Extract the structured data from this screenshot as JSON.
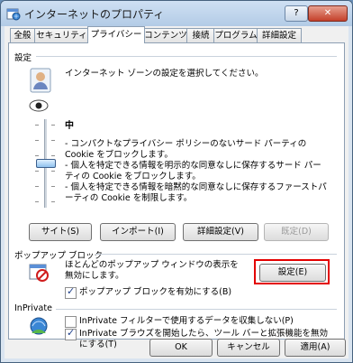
{
  "window": {
    "title": "インターネットのプロパティ",
    "help_label": "?",
    "close_label": "✕"
  },
  "tabs": [
    "全般",
    "セキュリティ",
    "プライバシー",
    "コンテンツ",
    "接続",
    "プログラム",
    "詳細設定"
  ],
  "settings": {
    "header": "設定",
    "description": "インターネット ゾーンの設定を選択してください。",
    "level": "中",
    "bullets": [
      "- コンパクトなプライバシー ポリシーのないサード パーティの Cookie をブロックします。",
      "- 個人を特定できる情報を明示的な同意なしに保存するサード パーティの Cookie をブロックします。",
      "- 個人を特定できる情報を暗黙的な同意なしに保存するファーストパーティの Cookie を制限します。"
    ],
    "slider_position": 0.5,
    "buttons": {
      "sites": "サイト(S)",
      "import": "インポート(I)",
      "advanced": "詳細設定(V)",
      "default": "既定(D)"
    }
  },
  "popup": {
    "header": "ポップアップ ブロック",
    "description": "ほとんどのポップアップ ウィンドウの表示を無効にします。",
    "settings_button": "設定(E)",
    "checkbox_label": "ポップアップ ブロックを有効にする(B)",
    "checkbox_checked": true,
    "highlight_color": "#e30000"
  },
  "inprivate": {
    "header": "InPrivate",
    "cb1_label": "InPrivate フィルターで使用するデータを収集しない(P)",
    "cb1_checked": false,
    "cb2_label": "InPrivate ブラウズを開始したら、ツール バーと拡張機能を無効にする(T)",
    "cb2_checked": true
  },
  "footer": {
    "ok": "OK",
    "cancel": "キャンセル",
    "apply": "適用(A)"
  }
}
